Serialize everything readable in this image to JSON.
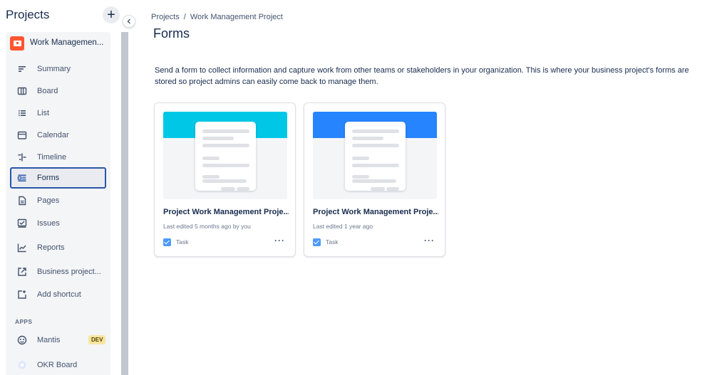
{
  "sidebar": {
    "title": "Projects",
    "add_label": "+",
    "project_name": "Work Managemen...",
    "items": [
      {
        "label": "Summary",
        "icon": "summary-icon"
      },
      {
        "label": "Board",
        "icon": "board-icon"
      },
      {
        "label": "List",
        "icon": "list-icon"
      },
      {
        "label": "Calendar",
        "icon": "calendar-icon"
      },
      {
        "label": "Timeline",
        "icon": "timeline-icon"
      },
      {
        "label": "Forms",
        "icon": "forms-icon",
        "selected": true
      },
      {
        "label": "Pages",
        "icon": "pages-icon"
      },
      {
        "label": "Issues",
        "icon": "issues-icon"
      },
      {
        "label": "Reports",
        "icon": "reports-icon"
      },
      {
        "label": "Business project...",
        "icon": "external-link-icon"
      },
      {
        "label": "Add shortcut",
        "icon": "add-shortcut-icon"
      }
    ],
    "apps_heading": "APPS",
    "apps": [
      {
        "label": "Mantis",
        "badge": "DEV",
        "icon": "mantis-icon"
      },
      {
        "label": "OKR Board",
        "icon": "okr-icon"
      }
    ]
  },
  "breadcrumb": {
    "root": "Projects",
    "separator": "/",
    "current": "Work Management Project"
  },
  "page": {
    "title": "Forms",
    "description": "Send a form to collect information and capture work from other teams or stakeholders in your organization. This is where your business project's forms are stored so project admins can easily come back to manage them."
  },
  "forms": [
    {
      "title": "Project Work Management Proje...",
      "meta": "Last edited 5 months ago by you",
      "type": "Task",
      "band_color": "#00c7e6",
      "more": "···"
    },
    {
      "title": "Project Work Management Proje...",
      "meta": "Last edited 1 year ago",
      "type": "Task",
      "band_color": "#2684ff",
      "more": "···"
    }
  ],
  "colors": {
    "accent": "#2a55a8",
    "project_avatar": "#ff5630",
    "dev_badge": "#f8e6a0"
  }
}
